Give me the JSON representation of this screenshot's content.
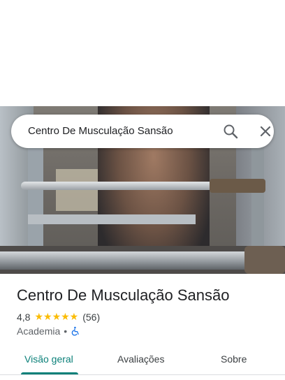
{
  "search": {
    "query": "Centro De Musculação Sansão",
    "search_icon": "search-icon",
    "close_icon": "close-icon"
  },
  "photo": {
    "description_icon": "place-photo"
  },
  "place": {
    "title": "Centro De Musculação Sansão",
    "rating": "4,8",
    "stars": "★★★★★",
    "star_count": 5,
    "reviews": "(56)",
    "category": "Academia",
    "separator": "•",
    "accessibility_icon": "wheelchair-icon"
  },
  "tabs": [
    {
      "label": "Visão geral",
      "active": true
    },
    {
      "label": "Avaliações",
      "active": false
    },
    {
      "label": "Sobre",
      "active": false
    }
  ],
  "colors": {
    "accent": "#0b8079",
    "star": "#fbbc04",
    "accessibility": "#1a73e8"
  }
}
